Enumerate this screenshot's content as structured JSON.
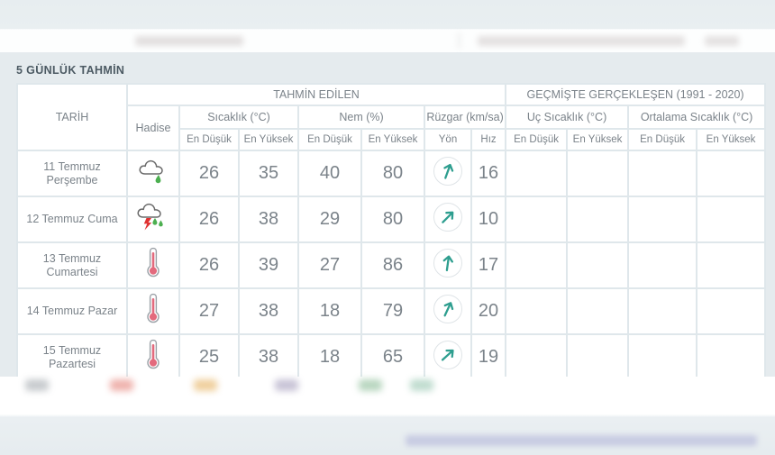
{
  "page": {
    "background_color": "#e5ebee",
    "card_title": "5 GÜNLÜK TAHMİN"
  },
  "colors": {
    "temp_low": "#5a9bb0",
    "temp_high": "#d06f7f",
    "hum_low": "#e0b158",
    "hum_high": "#8f8fa8",
    "wind": "#4fa389",
    "header_text": "#7b838a",
    "grid": "#dfe7eb",
    "title": "#4c5a63"
  },
  "table": {
    "group_headers": {
      "date": "TARİH",
      "forecast": "TAHMİN EDİLEN",
      "historical": "GEÇMİŞTE GERÇEKLEŞEN (1991 - 2020)"
    },
    "sub_headers": {
      "event": "Hadise",
      "temperature": "Sıcaklık (°C)",
      "humidity": "Nem (%)",
      "wind": "Rüzgar (km/sa)",
      "extreme_temp": "Uç Sıcaklık (°C)",
      "average_temp": "Ortalama Sıcaklık (°C)"
    },
    "leaf_headers": {
      "temp_low": "En Düşük",
      "temp_high": "En Yüksek",
      "hum_low": "En Düşük",
      "hum_high": "En Yüksek",
      "wind_direction": "Yön",
      "wind_speed": "Hız",
      "ext_low": "En Düşük",
      "ext_high": "En Yüksek",
      "avg_low": "En Düşük",
      "avg_high": "En Yüksek"
    },
    "rows": [
      {
        "date_line1": "11 Temmuz",
        "date_line2": "Perşembe",
        "icon": "cloud-rain-icon",
        "temp_low": "26",
        "temp_high": "35",
        "hum_low": "40",
        "hum_high": "80",
        "wind_direction_icon": "wind-arrow-icon",
        "wind_direction_deg": 200,
        "wind_speed": "16",
        "ext_low": "",
        "ext_high": "",
        "avg_low": "",
        "avg_high": ""
      },
      {
        "date_line1": "12 Temmuz Cuma",
        "date_line2": "",
        "icon": "cloud-thunderstorm-rain-icon",
        "temp_low": "26",
        "temp_high": "38",
        "hum_low": "29",
        "hum_high": "80",
        "wind_direction_icon": "wind-arrow-icon",
        "wind_direction_deg": 225,
        "wind_speed": "10",
        "ext_low": "",
        "ext_high": "",
        "avg_low": "",
        "avg_high": ""
      },
      {
        "date_line1": "13 Temmuz",
        "date_line2": "Cumartesi",
        "icon": "thermometer-icon",
        "temp_low": "26",
        "temp_high": "39",
        "hum_low": "27",
        "hum_high": "86",
        "wind_direction_icon": "wind-arrow-icon",
        "wind_direction_deg": 188,
        "wind_speed": "17",
        "ext_low": "",
        "ext_high": "",
        "avg_low": "",
        "avg_high": ""
      },
      {
        "date_line1": "14 Temmuz Pazar",
        "date_line2": "",
        "icon": "thermometer-icon",
        "temp_low": "27",
        "temp_high": "38",
        "hum_low": "18",
        "hum_high": "79",
        "wind_direction_icon": "wind-arrow-icon",
        "wind_direction_deg": 205,
        "wind_speed": "20",
        "ext_low": "",
        "ext_high": "",
        "avg_low": "",
        "avg_high": ""
      },
      {
        "date_line1": "15 Temmuz",
        "date_line2": "Pazartesi",
        "icon": "thermometer-icon",
        "temp_low": "25",
        "temp_high": "38",
        "hum_low": "18",
        "hum_high": "65",
        "wind_direction_icon": "wind-arrow-icon",
        "wind_direction_deg": 228,
        "wind_speed": "19",
        "ext_low": "",
        "ext_high": "",
        "avg_low": "",
        "avg_high": ""
      }
    ]
  }
}
